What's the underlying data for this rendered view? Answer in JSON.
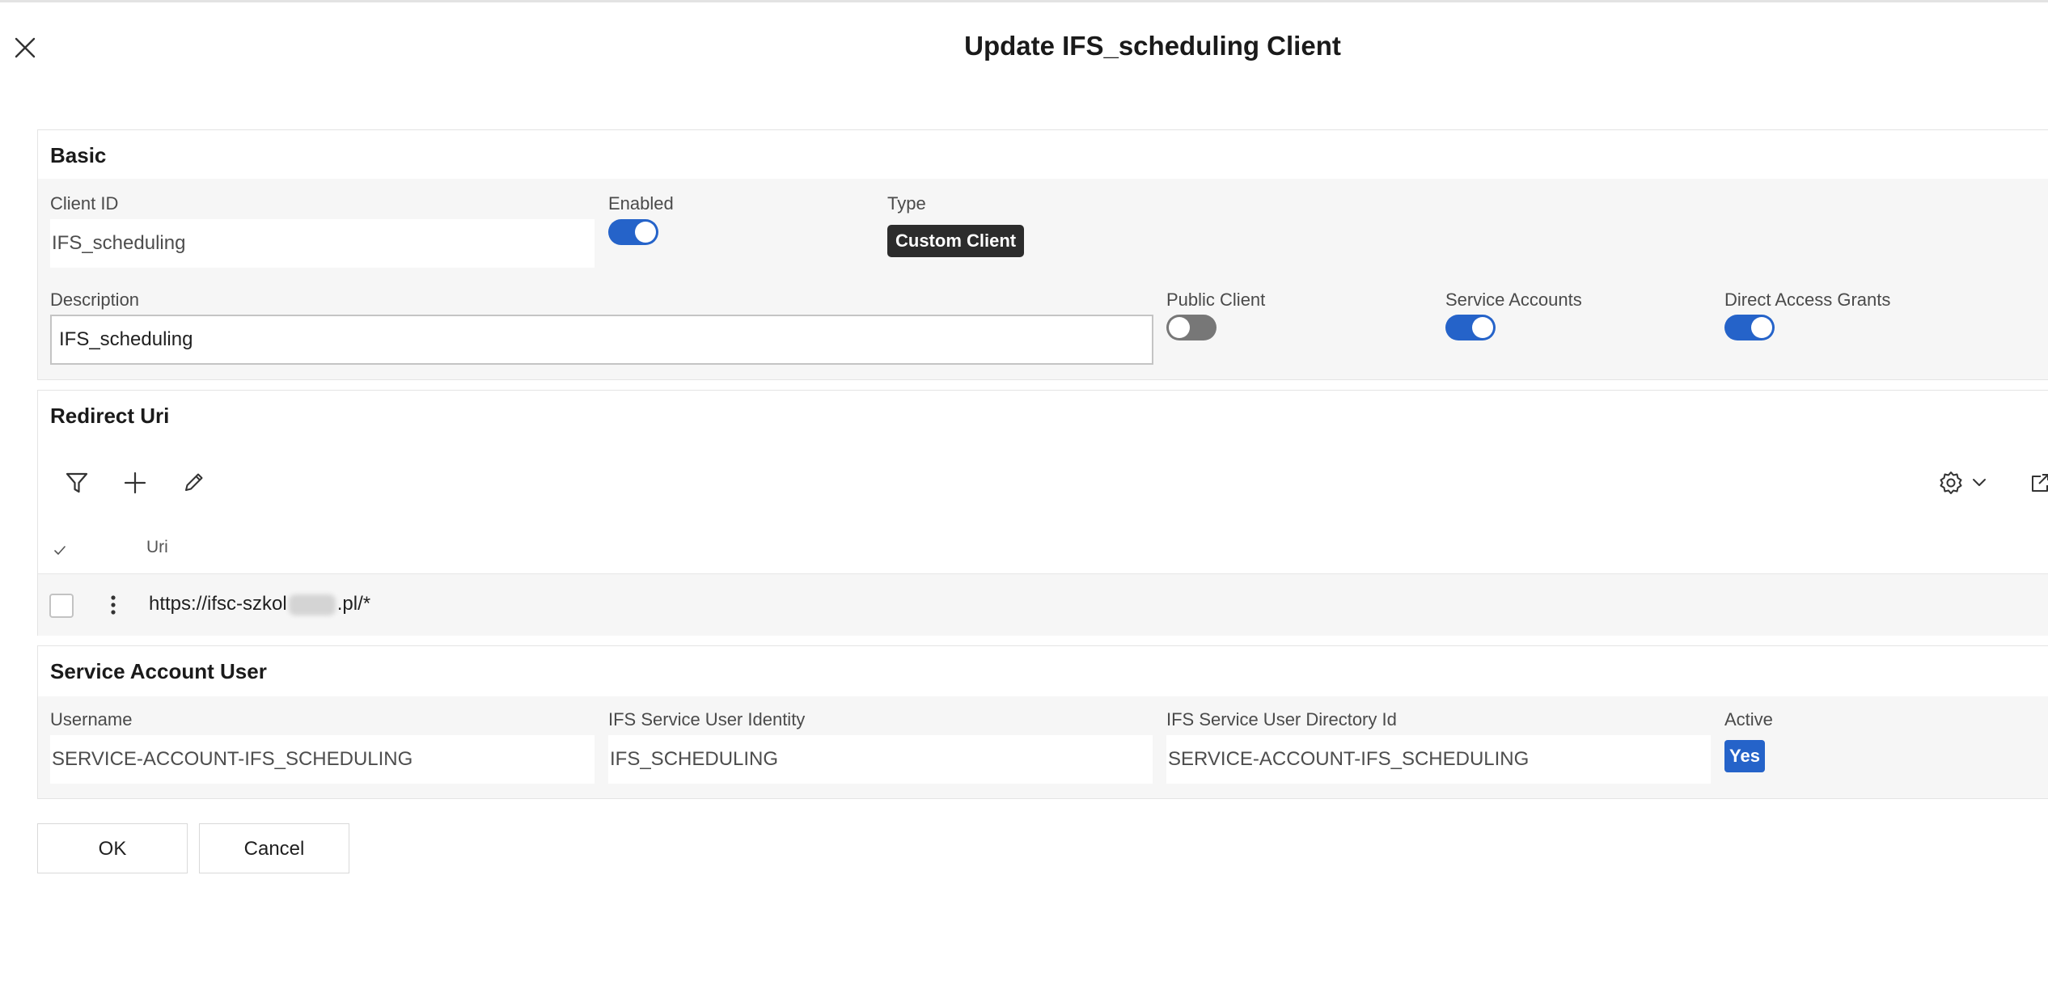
{
  "dialog": {
    "title": "Update IFS_scheduling Client"
  },
  "basic": {
    "title": "Basic",
    "client_id": {
      "label": "Client ID",
      "value": "IFS_scheduling"
    },
    "enabled": {
      "label": "Enabled",
      "on": true
    },
    "type": {
      "label": "Type",
      "value": "Custom Client"
    },
    "description": {
      "label": "Description",
      "value": "IFS_scheduling"
    },
    "public_client": {
      "label": "Public Client",
      "on": false
    },
    "service_accounts": {
      "label": "Service Accounts",
      "on": true
    },
    "direct_access_grants": {
      "label": "Direct Access Grants",
      "on": true
    }
  },
  "redirect_uri": {
    "title": "Redirect Uri",
    "columns": [
      "Uri"
    ],
    "rows": [
      {
        "uri_prefix": "https://ifsc-szkol",
        "uri_suffix": ".pl/*"
      }
    ]
  },
  "service_account_user": {
    "title": "Service Account User",
    "username": {
      "label": "Username",
      "value": "SERVICE-ACCOUNT-IFS_SCHEDULING"
    },
    "identity": {
      "label": "IFS Service User Identity",
      "value": "IFS_SCHEDULING"
    },
    "directory_id": {
      "label": "IFS Service User Directory Id",
      "value": "SERVICE-ACCOUNT-IFS_SCHEDULING"
    },
    "active": {
      "label": "Active",
      "value": "Yes"
    }
  },
  "footer": {
    "ok_label": "OK",
    "cancel_label": "Cancel"
  },
  "colors": {
    "accent": "#2563c9",
    "dark_badge": "#2c2c2c",
    "panel_bg": "#f6f6f6"
  }
}
